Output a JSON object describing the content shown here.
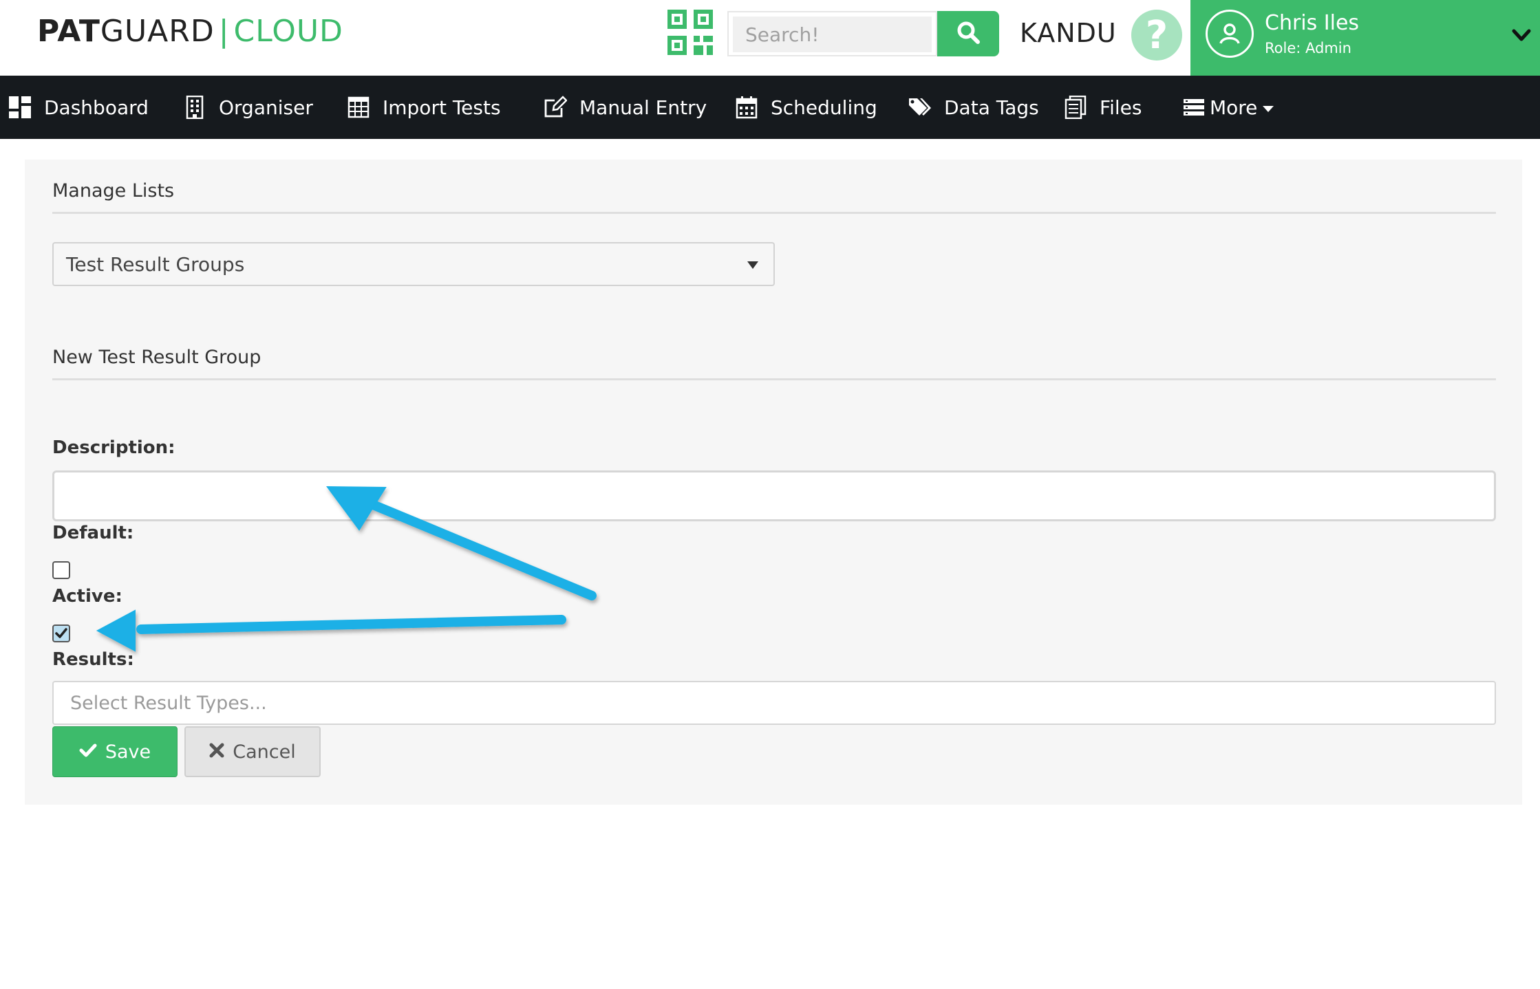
{
  "brand": {
    "part1": "PAT",
    "part2": "GUARD",
    "separator": "|",
    "part3": "CLOUD",
    "accent_color": "#3dbb6b"
  },
  "header": {
    "qr_icon": "qr-code-icon",
    "search_placeholder": "Search!",
    "search_icon": "search-icon",
    "org_name": "KANDU",
    "help_icon": "question-icon",
    "user": {
      "name": "Chris Iles",
      "role": "Role: Admin",
      "avatar_icon": "user-circle-icon",
      "chevron_icon": "chevron-down-icon"
    }
  },
  "nav": {
    "items": [
      {
        "label": "Dashboard",
        "icon": "dashboard-icon"
      },
      {
        "label": "Organiser",
        "icon": "building-icon"
      },
      {
        "label": "Import Tests",
        "icon": "table-grid-icon"
      },
      {
        "label": "Manual Entry",
        "icon": "edit-icon"
      },
      {
        "label": "Scheduling",
        "icon": "calendar-icon"
      },
      {
        "label": "Data Tags",
        "icon": "tags-icon"
      },
      {
        "label": "Files",
        "icon": "files-icon"
      },
      {
        "label": "More",
        "icon": "menu-list-icon"
      }
    ]
  },
  "main": {
    "section_title": "Manage Lists",
    "list_select_value": "Test Result Groups",
    "form_title": "New Test Result Group",
    "description_label": "Description:",
    "description_value": "",
    "default_label": "Default:",
    "default_checked": false,
    "active_label": "Active:",
    "active_checked": true,
    "results_label": "Results:",
    "results_placeholder": "Select Result Types...",
    "save_label": "Save",
    "cancel_label": "Cancel"
  },
  "annotations": {
    "arrow_color": "#1ab0e6"
  }
}
